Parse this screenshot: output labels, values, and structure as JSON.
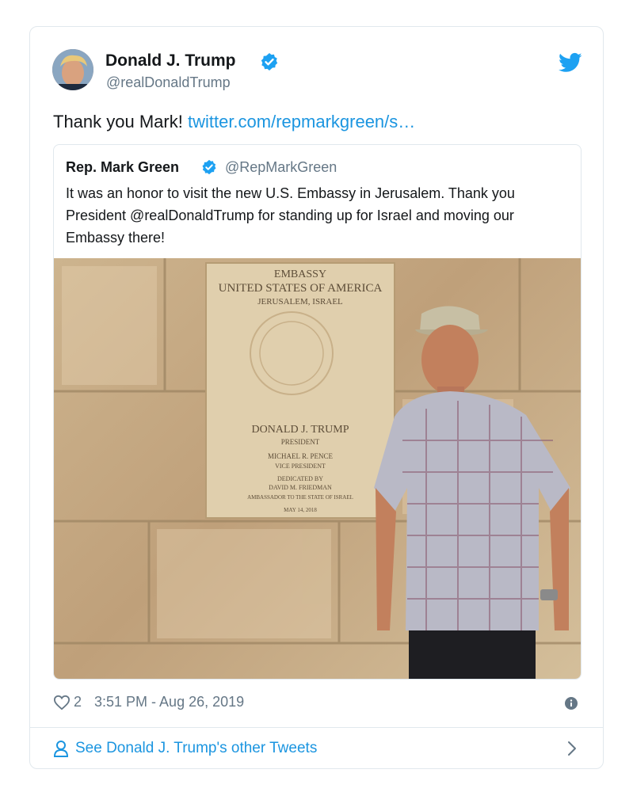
{
  "author": {
    "name": "Donald J. Trump",
    "handle": "@realDonaldTrump"
  },
  "tweet": {
    "text": "Thank you Mark!",
    "link": "twitter.com/repmarkgreen/s…"
  },
  "quoted": {
    "name": "Rep. Mark Green",
    "handle": "@RepMarkGreen",
    "text": "It was an honor to visit the new U.S. Embassy in Jerusalem. Thank you President @realDonaldTrump for standing up for Israel and moving our Embassy there!"
  },
  "plaque": {
    "line1": "EMBASSY",
    "line2": "UNITED STATES OF AMERICA",
    "line3": "JERUSALEM, ISRAEL",
    "line4": "DONALD J. TRUMP",
    "line5": "PRESIDENT",
    "line6": "MICHAEL R. PENCE",
    "line7": "VICE PRESIDENT",
    "line8": "DEDICATED BY",
    "line9": "DAVID M. FRIEDMAN",
    "line10": "AMBASSADOR TO THE STATE OF ISRAEL",
    "line11": "MAY 14, 2018"
  },
  "meta": {
    "likes": "2",
    "timestamp": "3:51 PM - Aug 26, 2019"
  },
  "footer": {
    "other_tweets": "See Donald J. Trump's other Tweets"
  },
  "colors": {
    "link": "#1b95e0",
    "verified": "#1da1f2",
    "muted": "#657786"
  },
  "icons": [
    "verified-badge-icon",
    "twitter-bird-icon",
    "heart-icon",
    "info-icon",
    "person-icon",
    "chevron-right-icon"
  ]
}
